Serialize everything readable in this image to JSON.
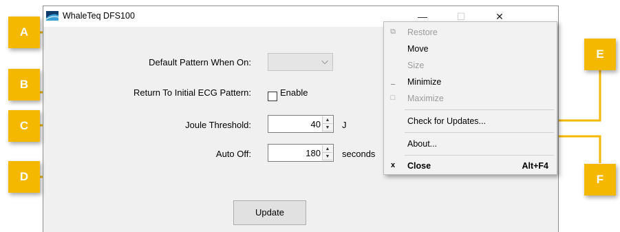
{
  "window": {
    "title": "WhaleTeq DFS100",
    "minimize_glyph": "—",
    "maximize_glyph": "☐",
    "close_glyph": "✕"
  },
  "form": {
    "default_pattern_label": "Default Pattern When On:",
    "default_pattern_value": "",
    "return_initial_label": "Return To Initial ECG Pattern:",
    "enable_label": "Enable",
    "enable_checked": false,
    "joule_threshold_label": "Joule Threshold:",
    "joule_threshold_value": "40",
    "joule_unit": "J",
    "auto_off_label": "Auto Off:",
    "auto_off_value": "180",
    "auto_off_unit": "seconds",
    "update_button": "Update"
  },
  "system_menu": {
    "items": [
      {
        "label": "Restore",
        "icon": "restore-icon",
        "enabled": false
      },
      {
        "label": "Move",
        "icon": "",
        "enabled": true
      },
      {
        "label": "Size",
        "icon": "",
        "enabled": false
      },
      {
        "label": "Minimize",
        "icon": "minimize-icon",
        "enabled": true
      },
      {
        "label": "Maximize",
        "icon": "maximize-icon",
        "enabled": false
      },
      {
        "label": "Check for Updates...",
        "icon": "",
        "enabled": true
      },
      {
        "label": "About...",
        "icon": "",
        "enabled": true
      },
      {
        "label": "Close",
        "icon": "close-icon",
        "enabled": true,
        "shortcut": "Alt+F4"
      }
    ]
  },
  "callouts": [
    "A",
    "B",
    "C",
    "D",
    "E",
    "F"
  ],
  "colors": {
    "callout": "#f5b800",
    "window_bg": "#f0f0f0",
    "menu_bg": "#f2f2f2"
  }
}
